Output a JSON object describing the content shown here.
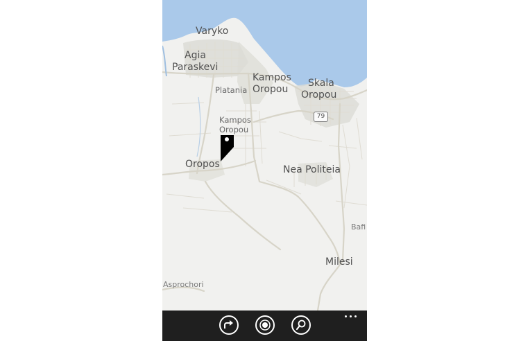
{
  "map": {
    "water_color": "#aac9ea",
    "land_color": "#f1f1ef",
    "road_color": "#d9d6cb",
    "built_area_color": "#dcdcd6",
    "place_labels": [
      {
        "id": "varyko",
        "text": "Varyko"
      },
      {
        "id": "agia",
        "text": "Agia"
      },
      {
        "id": "paraskevi",
        "text": "Paraskevi"
      },
      {
        "id": "kampos-1",
        "text": "Kampos"
      },
      {
        "id": "oropou-1",
        "text": "Oropou"
      },
      {
        "id": "skala",
        "text": "Skala"
      },
      {
        "id": "oropou-2",
        "text": "Oropou"
      },
      {
        "id": "platania",
        "text": "Platania"
      },
      {
        "id": "kampos-small",
        "text": "Kampos"
      },
      {
        "id": "oropou-small",
        "text": "Oropou"
      },
      {
        "id": "oropos",
        "text": "Oropos"
      },
      {
        "id": "nea-politeia",
        "text": "Nea Politeia"
      },
      {
        "id": "bafi",
        "text": "Bafi"
      },
      {
        "id": "milesi",
        "text": "Milesi"
      },
      {
        "id": "asprochori",
        "text": "Asprochori"
      }
    ],
    "road_shield": "79",
    "pin": {
      "icon": "map-pin-icon"
    }
  },
  "appbar": {
    "background": "#1f1f1f",
    "buttons": [
      {
        "icon": "directions-icon"
      },
      {
        "icon": "my-location-icon"
      },
      {
        "icon": "search-icon"
      }
    ],
    "more_icon": "more-dots-icon"
  }
}
